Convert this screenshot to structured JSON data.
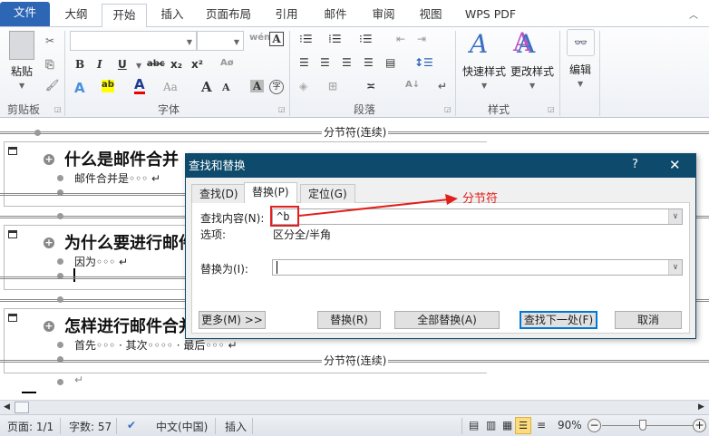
{
  "tabs": [
    {
      "label": "文件"
    },
    {
      "label": "大纲"
    },
    {
      "label": "开始"
    },
    {
      "label": "插入"
    },
    {
      "label": "页面布局"
    },
    {
      "label": "引用"
    },
    {
      "label": "邮件"
    },
    {
      "label": "审阅"
    },
    {
      "label": "视图"
    },
    {
      "label": "WPS PDF"
    }
  ],
  "ribbon": {
    "clipboard": {
      "paste": "粘贴",
      "label": "剪贴板"
    },
    "font": {
      "label": "字体",
      "name_value": "",
      "size_value": "",
      "bold": "B",
      "italic": "I",
      "underline": "U",
      "strike": "abc",
      "sub": "x₂",
      "sup": "x²",
      "font_color": "A",
      "change_case": "Aa",
      "grow": "A",
      "shrink": "A",
      "shade": "A",
      "phonetic": "wén",
      "enclose": "字"
    },
    "paragraph": {
      "label": "段落"
    },
    "styles": {
      "label": "样式",
      "quick": "快速样式",
      "change": "更改样式"
    },
    "editing": {
      "label": "编辑"
    }
  },
  "document": {
    "section_break": "分节符(连续)",
    "sections": [
      {
        "heading": "什么是邮件合并",
        "body": "邮件合并是◦◦◦ ↵"
      },
      {
        "heading": "为什么要进行邮件合并",
        "body": "因为◦◦◦ ↵"
      },
      {
        "heading": "怎样进行邮件合并",
        "body": "首先◦◦◦ · 其次◦◦◦◦ · 最后◦◦◦ ↵"
      }
    ],
    "empty_para": "↵"
  },
  "dialog": {
    "title": "查找和替换",
    "help": "?",
    "close": "✕",
    "tabs": [
      {
        "label": "查找(D)"
      },
      {
        "label": "替换(P)"
      },
      {
        "label": "定位(G)"
      }
    ],
    "find_label": "查找内容(N):",
    "find_value": "^b",
    "options_label": "选项:",
    "options_value": "区分全/半角",
    "replace_label": "替换为(I):",
    "replace_value": "",
    "buttons": {
      "more": "更多(M) >>",
      "replace": "替换(R)",
      "replace_all": "全部替换(A)",
      "find_next": "查找下一处(F)",
      "cancel": "取消"
    },
    "annotation": "分节符",
    "annotation_color": "#e0201c"
  },
  "status": {
    "page": "页面: 1/1",
    "words": "字数: 57",
    "language": "中文(中国)",
    "mode": "插入",
    "zoom": "90%",
    "zoom_fraction": 0.45
  }
}
